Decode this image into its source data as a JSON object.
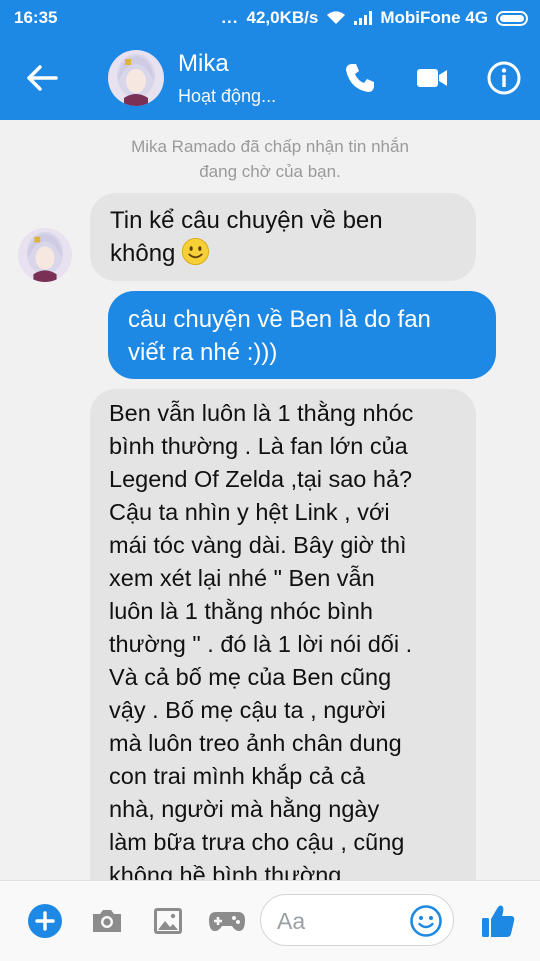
{
  "status_bar": {
    "time": "16:35",
    "dots": "...",
    "speed": "42,0KB/s",
    "carrier": "MobiFone 4G"
  },
  "header": {
    "name": "Mika",
    "status": "Hoạt động...",
    "accent": "#1e88e5"
  },
  "conversation": {
    "system_note": "Mika Ramado đã chấp nhận tin nhắn\nđang chờ của bạn.",
    "messages": [
      {
        "sender": "Mika",
        "text": "Tin kể câu chuyện về ben\nkhông",
        "emoji": "smiley"
      },
      {
        "sender": "me",
        "text": "câu chuyện về Ben là do fan\nviết ra nhé :)))"
      },
      {
        "sender": "Mika",
        "text": "Ben vẫn luôn là 1 thằng nhóc\nbình thường . Là fan lớn của\nLegend Of Zelda ,tại sao hả?\nCậu ta nhìn y hệt Link , với\nmái tóc vàng dài. Bây giờ thì\nxem xét lại nhé \" Ben vẫn\nluôn là 1 thằng nhóc bình\nthường \" . đó là 1 lời nói dối .\nVà cả bố mẹ của Ben cũng\nvậy . Bố mẹ cậu ta , người\nmà luôn treo ảnh chân dung\ncon trai mình khắp cả cả\nnhà, người mà hằng ngày\nlàm bữa trưa cho cậu , cũng\nkhông hề bình thường."
      }
    ]
  },
  "composer": {
    "placeholder": "Aa",
    "icons": [
      "plus-icon",
      "camera-icon",
      "image-icon",
      "gamepad-icon",
      "smiley-icon",
      "thumbs-up-icon"
    ]
  }
}
